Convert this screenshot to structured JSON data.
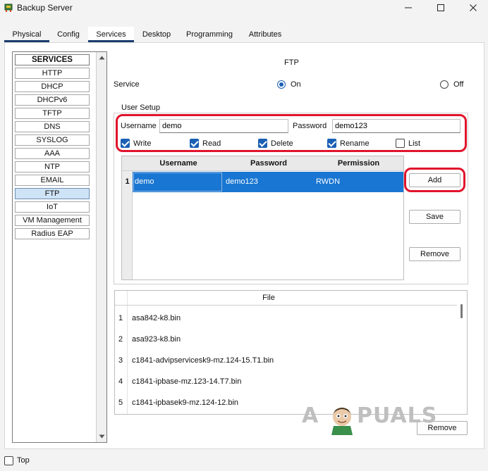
{
  "window": {
    "title": "Backup Server",
    "icon": "network-device-icon"
  },
  "tabs": [
    {
      "label": "Physical"
    },
    {
      "label": "Config"
    },
    {
      "label": "Services"
    },
    {
      "label": "Desktop"
    },
    {
      "label": "Programming"
    },
    {
      "label": "Attributes"
    }
  ],
  "active_tab": "Services",
  "sidebar": {
    "header": "SERVICES",
    "items": [
      "HTTP",
      "DHCP",
      "DHCPv6",
      "TFTP",
      "DNS",
      "SYSLOG",
      "AAA",
      "NTP",
      "EMAIL",
      "FTP",
      "IoT",
      "VM Management",
      "Radius EAP"
    ],
    "selected": "FTP"
  },
  "ftp": {
    "title": "FTP",
    "service_label": "Service",
    "on_label": "On",
    "off_label": "Off",
    "service_state": "On"
  },
  "user_setup": {
    "legend": "User Setup",
    "username_label": "Username",
    "username_value": "demo",
    "password_label": "Password",
    "password_value": "demo123",
    "permissions": [
      {
        "label": "Write",
        "checked": true
      },
      {
        "label": "Read",
        "checked": true
      },
      {
        "label": "Delete",
        "checked": true
      },
      {
        "label": "Rename",
        "checked": true
      },
      {
        "label": "List",
        "checked": false
      }
    ]
  },
  "user_table": {
    "columns": [
      "Username",
      "Password",
      "Permission"
    ],
    "rows": [
      {
        "num": "1",
        "username": "demo",
        "password": "demo123",
        "permission": "RWDN"
      }
    ]
  },
  "buttons": {
    "add": "Add",
    "save": "Save",
    "remove": "Remove",
    "file_remove": "Remove"
  },
  "file_table": {
    "column": "File",
    "rows": [
      {
        "num": "1",
        "name": "asa842-k8.bin"
      },
      {
        "num": "2",
        "name": "asa923-k8.bin"
      },
      {
        "num": "3",
        "name": "c1841-advipservicesk9-mz.124-15.T1.bin"
      },
      {
        "num": "4",
        "name": "c1841-ipbase-mz.123-14.T7.bin"
      },
      {
        "num": "5",
        "name": "c1841-ipbasek9-mz.124-12.bin"
      }
    ]
  },
  "watermark": {
    "text": "APPUALS"
  },
  "bottom": {
    "top_label": "Top",
    "top_checked": false
  },
  "colors": {
    "accent": "#1a5fb4",
    "selection": "#1976d2",
    "highlight": "#e0142c",
    "tab_underline": "#1a3d6e"
  }
}
